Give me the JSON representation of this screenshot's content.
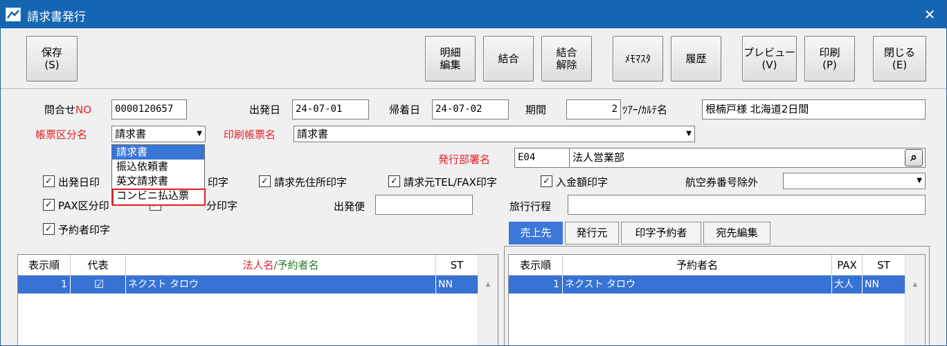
{
  "window": {
    "title": "請求書発行",
    "close": "✕"
  },
  "toolbar": {
    "save": "保存\n(S)",
    "meisai": "明細\n編集",
    "ketsugo": "結合",
    "kaijo": "結合\n解除",
    "memo": "ﾒﾓﾏｽﾀ",
    "rireki": "履歴",
    "preview": "プレビュー\n(V)",
    "print": "印刷\n(P)",
    "close": "閉じる\n(E)"
  },
  "form": {
    "inquiry_label": "問合せ",
    "inquiry_no": "NO",
    "inquiry_value": "0000120657",
    "depart_label": "出発日",
    "depart_value": "24-07-01",
    "return_label": "帰着日",
    "return_value": "24-07-02",
    "period_label": "期間",
    "period_value": "2",
    "tour_label": "ﾂｱｰ/ｶﾙﾃ名",
    "tour_value": "根楠戸様 北海道2日間",
    "doctype_label": "帳票区分名",
    "doctype_value": "請求書",
    "printname_label": "印刷帳票名",
    "printname_value": "請求書",
    "dept_label": "発行部署名",
    "dept_code": "E04",
    "dept_name": "法人営業部",
    "cb_depart": "出発日印",
    "cb_depart_tail": "印字",
    "cb_address": "請求先住所印字",
    "cb_tel": "請求元TEL/FAX印字",
    "cb_amount": "入金額印字",
    "ticket_label": "航空券番号除外",
    "cb_pax": "PAX区分印",
    "cb_pax_tail": "分印字",
    "flight_label": "出発便",
    "itinerary_label": "旅行行程",
    "cb_booker": "予約者印字",
    "check_mark": "✓"
  },
  "dropdown": {
    "items": [
      "請求書",
      "振込依頼書",
      "英文請求書",
      "コンビニ払込票"
    ],
    "selected": 0
  },
  "tabs": [
    "売上先",
    "発行元",
    "印字予約者",
    "宛先編集"
  ],
  "left_grid": {
    "headers": [
      "表示順",
      "代表",
      "法人名/予約者名",
      "ST"
    ],
    "header_split": [
      "法人名",
      "/予約者名"
    ],
    "rows": [
      {
        "order": "1",
        "rep": "☑",
        "name": "ネクスト タロウ",
        "st": "NN"
      }
    ]
  },
  "right_grid": {
    "headers": [
      "表示順",
      "予約者名",
      "PAX",
      "ST"
    ],
    "rows": [
      {
        "order": "1",
        "name": "ネクスト タロウ",
        "pax": "大人",
        "st": "NN"
      }
    ]
  },
  "icons": {
    "scroll_up": "▲",
    "combo_arrow": "▼",
    "search": "⌕"
  }
}
